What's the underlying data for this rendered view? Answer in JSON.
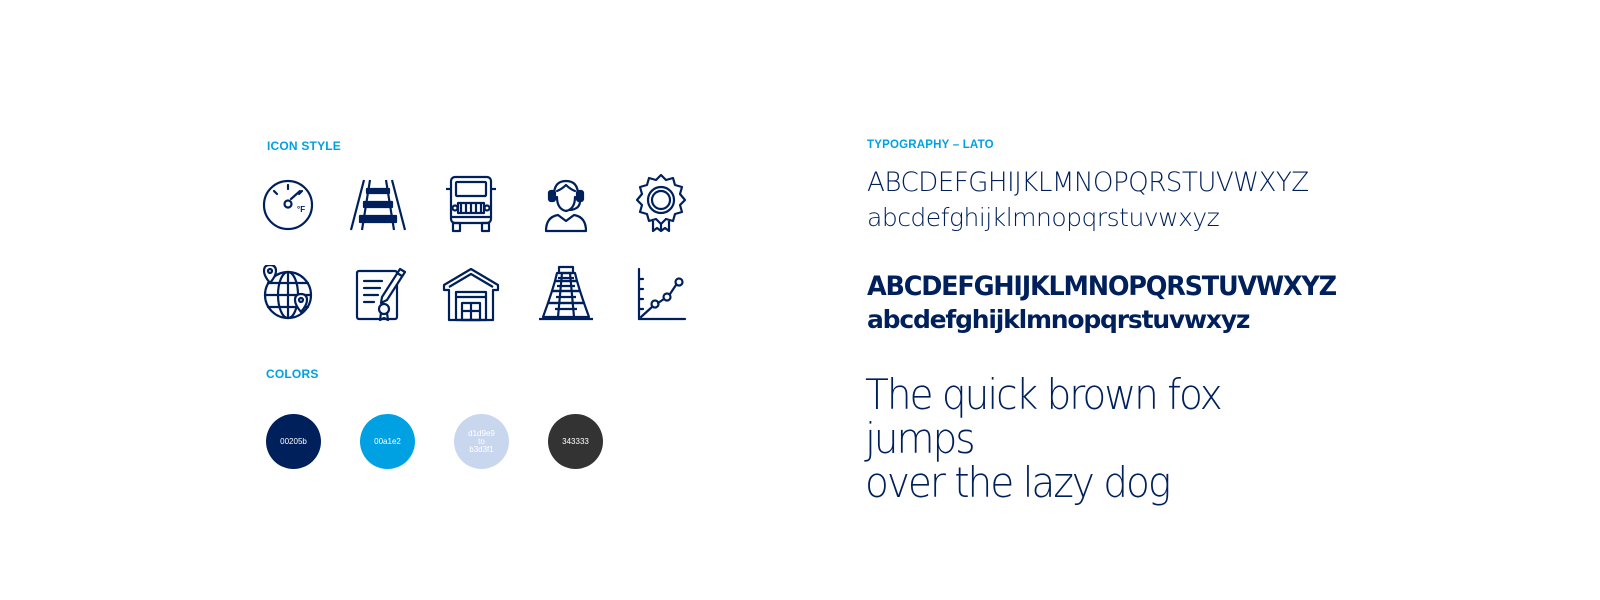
{
  "icon_section": {
    "label": "ICON STYLE",
    "icons": [
      "gauge-fahrenheit-icon",
      "railroad-track-icon",
      "truck-front-icon",
      "headset-agent-icon",
      "award-seal-icon",
      "globe-location-pins-icon",
      "certified-document-icon",
      "warehouse-icon",
      "pyramid-icon",
      "line-graph-icon"
    ],
    "icon_color": "#00205b"
  },
  "colors_section": {
    "label": "COLORS",
    "swatches": [
      {
        "color": "#00205b",
        "label": "00205b"
      },
      {
        "color": "#00a1e2",
        "label": "00a1e2"
      },
      {
        "color": "#c9d7ee",
        "label_lines": [
          "d1d9e9",
          "to",
          "b3d3f1"
        ]
      },
      {
        "color": "#343333",
        "label": "343333"
      }
    ]
  },
  "typography_section": {
    "label": "TYPOGRAPHY – LATO",
    "uppercase_light": "ABCDEFGHIJKLMNOPQRSTUVWXYZ",
    "lowercase_light": "abcdefghijklmnopqrstuvwxyz",
    "uppercase_bold": "ABCDEFGHIJKLMNOPQRSTUVWXYZ",
    "lowercase_bold": "abcdefghijklmnopqrstuvwxyz",
    "pangram_line1": "The quick brown fox jumps",
    "pangram_line2": "over the lazy dog"
  },
  "accent_color": "#00a1e2",
  "primary_color": "#00205b"
}
